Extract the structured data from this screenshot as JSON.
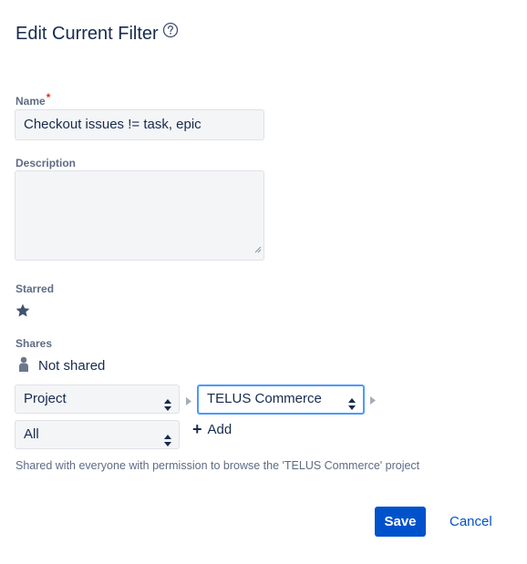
{
  "dialog": {
    "title": "Edit Current Filter"
  },
  "form": {
    "name_label": "Name",
    "name_required_mark": "*",
    "name_value": "Checkout issues != task, epic",
    "description_label": "Description",
    "description_value": "",
    "starred_label": "Starred",
    "shares_label": "Shares",
    "shares_status": "Not shared",
    "share_type_select": "Project",
    "project_select": "TELUS Commerce",
    "role_select": "All",
    "add_label": "Add",
    "share_note": "Shared with everyone with permission to browse the 'TELUS Commerce' project"
  },
  "footer": {
    "save_label": "Save",
    "cancel_label": "Cancel"
  },
  "colors": {
    "primary": "#0052cc",
    "required": "#de350b",
    "focus": "#4c9aff",
    "field_bg": "#f4f5f7"
  },
  "icons": {
    "help": "help-icon",
    "star": "star-icon",
    "person": "person-icon",
    "select_arrows": "up-down-arrows-icon",
    "plus": "plus-icon"
  }
}
